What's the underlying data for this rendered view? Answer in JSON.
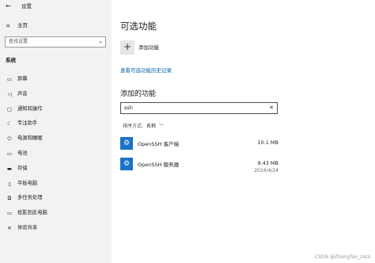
{
  "window": {
    "back_glyph": "←",
    "title": "设置"
  },
  "sidebar": {
    "home_label": "主页",
    "search_placeholder": "查找设置",
    "section_label": "系统",
    "items": [
      {
        "icon": "display-icon",
        "glyph": "▭",
        "label": "屏幕"
      },
      {
        "icon": "speaker-icon",
        "glyph": "◁",
        "label": "声音"
      },
      {
        "icon": "notifications-icon",
        "glyph": "▢",
        "label": "通知和操作"
      },
      {
        "icon": "focus-assist-icon",
        "glyph": "☾",
        "label": "专注助手"
      },
      {
        "icon": "power-sleep-icon",
        "glyph": "⏻",
        "label": "电源和睡眠"
      },
      {
        "icon": "battery-icon",
        "glyph": "▭",
        "label": "电池"
      },
      {
        "icon": "storage-icon",
        "glyph": "▬",
        "label": "存储"
      },
      {
        "icon": "tablet-icon",
        "glyph": "▯",
        "label": "平板电脑"
      },
      {
        "icon": "multitasking-icon",
        "glyph": "⧉",
        "label": "多任务处理"
      },
      {
        "icon": "projecting-icon",
        "glyph": "▭",
        "label": "投影到此电脑"
      },
      {
        "icon": "shared-experiences-icon",
        "glyph": "✕",
        "label": "体验共享"
      }
    ]
  },
  "main": {
    "title": "可选功能",
    "add_glyph": "+",
    "add_label": "添加功能",
    "history_link": "查看可选功能历史记录",
    "subheading": "添加的功能",
    "filter_value": "ssh",
    "clear_glyph": "✕",
    "sort_label": "排序方式:",
    "sort_value": "名称",
    "features": [
      {
        "name": "OpenSSH 客户端",
        "size": "10.1 MB",
        "date": ""
      },
      {
        "name": "OpenSSH 服务器",
        "size": "9.43 MB",
        "date": "2024/4/24"
      }
    ]
  },
  "watermark": "CSDN @ZhangTao_zata",
  "colors": {
    "accent": "#0063b1",
    "sidebar_bg": "#f2f2f2",
    "feature_icon_bg": "#1a73c7"
  }
}
